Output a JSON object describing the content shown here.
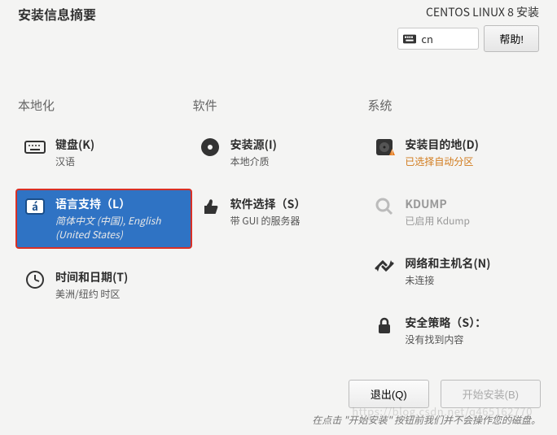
{
  "header": {
    "page_title": "安装信息摘要",
    "product_title": "CENTOS LINUX 8 安装",
    "keyboard_layout": "cn",
    "help_label": "帮助!"
  },
  "columns": {
    "local": {
      "label": "本地化",
      "keyboard": {
        "title": "键盘(K)",
        "sub": "汉语"
      },
      "language": {
        "title": "语言支持（L）",
        "sub": "简体中文 (中国), English (United States)"
      },
      "time": {
        "title": "时间和日期(T)",
        "sub": "美洲/纽约 时区"
      }
    },
    "software": {
      "label": "软件",
      "source": {
        "title": "安装源(I)",
        "sub": "本地介质"
      },
      "selection": {
        "title": "软件选择（S）",
        "sub": "带 GUI 的服务器"
      }
    },
    "system": {
      "label": "系统",
      "destination": {
        "title": "安装目的地(D)",
        "sub": "已选择自动分区"
      },
      "kdump": {
        "title": "KDUMP",
        "sub": "已启用 Kdump"
      },
      "network": {
        "title": "网络和主机名(N)",
        "sub": "未连接"
      },
      "security": {
        "title": "安全策略（S）：",
        "sub": "没有找到内容"
      }
    }
  },
  "footer": {
    "quit_label": "退出(Q)",
    "begin_label": "开始安装(B)",
    "hint": "在点击 \"开始安装\" 按钮前我们并不会操作您的磁盘。"
  },
  "watermark": "https://blog.csdn.net/q465162770"
}
